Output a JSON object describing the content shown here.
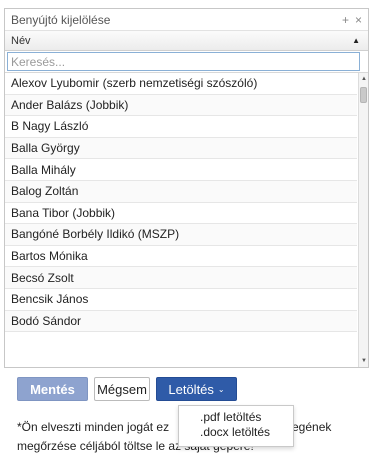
{
  "header": {
    "title": "Benyújtó kijelölése",
    "add_symbol": "+",
    "close_symbol": "×"
  },
  "column": {
    "name_header": "Név",
    "sort_icon": "sort-asc-icon",
    "sort_symbol": "▲"
  },
  "search": {
    "placeholder": "Keresés..."
  },
  "list": {
    "items": [
      "Alexov Lyubomir (szerb nemzetiségi szószóló)",
      "Ander Balázs (Jobbik)",
      "B Nagy László",
      "Balla György",
      "Balla Mihály",
      "Balog Zoltán",
      "Bana Tibor (Jobbik)",
      "Bangóné Borbély Ildikó (MSZP)",
      "Bartos Mónika",
      "Becsó Zsolt",
      "Bencsik János",
      "Bodó Sándor"
    ]
  },
  "scrollbar": {
    "up_symbol": "▲",
    "down_symbol": "▼"
  },
  "actions": {
    "save_label": "Mentés",
    "cancel_label": "Mégsem",
    "download_label": "Letöltés",
    "download_caret": "⌄"
  },
  "download_menu": {
    "items": [
      ".pdf letöltés",
      ".docx letöltés"
    ]
  },
  "note": {
    "line1_left": "*Ön elveszti minden jogát ez",
    "line1_right": "vegének",
    "line2": "megőrzése céljából töltse le az saját gépére!"
  },
  "colors": {
    "save_button": "#8ea3cf",
    "download_button": "#2f5ba8",
    "search_border": "#8ab0d6"
  }
}
